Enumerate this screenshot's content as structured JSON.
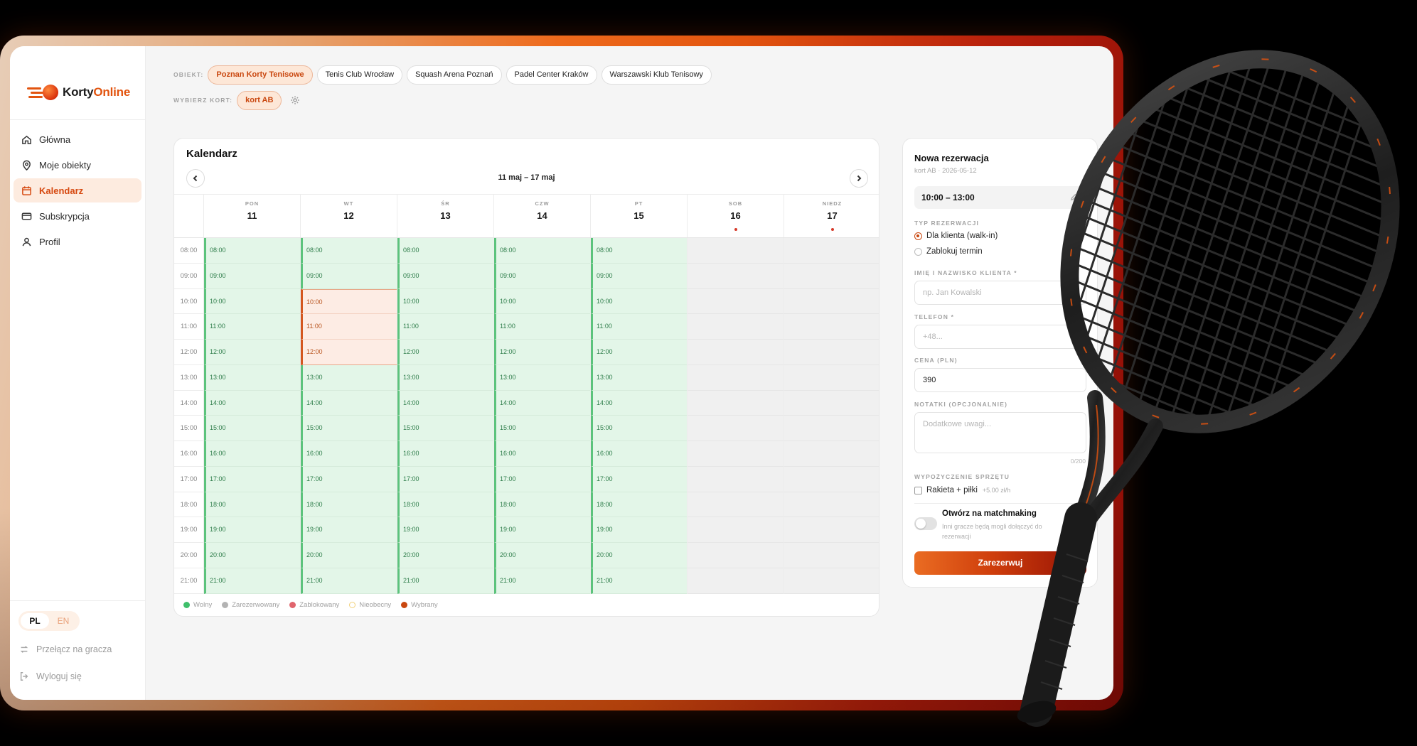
{
  "brand": {
    "name_part1": "Korty",
    "name_part2": "Online"
  },
  "sidebar": {
    "items": [
      {
        "label": "Główna",
        "icon": "home-icon",
        "active": false
      },
      {
        "label": "Moje obiekty",
        "icon": "map-pin-icon",
        "active": false
      },
      {
        "label": "Kalendarz",
        "icon": "calendar-icon",
        "active": true
      },
      {
        "label": "Subskrypcja",
        "icon": "card-icon",
        "active": false
      },
      {
        "label": "Profil",
        "icon": "user-icon",
        "active": false
      }
    ],
    "lang": {
      "pl": "PL",
      "en": "EN",
      "selected": "PL"
    },
    "switch_label": "Przełącz na gracza",
    "logout_label": "Wyloguj się"
  },
  "filters": {
    "facility_label": "OBIEKT:",
    "facilities": [
      "Poznan Korty Tenisowe",
      "Tenis Club Wrocław",
      "Squash Arena Poznań",
      "Padel Center Kraków",
      "Warszawski Klub Tenisowy"
    ],
    "selected_facility": "Poznan Korty Tenisowe",
    "court_label": "WYBIERZ KORT:",
    "court": "kort AB"
  },
  "calendar": {
    "title": "Kalendarz",
    "range": "11 maj – 17 maj",
    "days": [
      {
        "name": "PON",
        "date": "11",
        "marked": false,
        "available": true
      },
      {
        "name": "WT",
        "date": "12",
        "marked": false,
        "available": true
      },
      {
        "name": "ŚR",
        "date": "13",
        "marked": false,
        "available": true
      },
      {
        "name": "CZW",
        "date": "14",
        "marked": false,
        "available": true
      },
      {
        "name": "PT",
        "date": "15",
        "marked": false,
        "available": true
      },
      {
        "name": "SOB",
        "date": "16",
        "marked": true,
        "available": false
      },
      {
        "name": "NIEDZ",
        "date": "17",
        "marked": true,
        "available": false
      }
    ],
    "times": [
      "08:00",
      "09:00",
      "10:00",
      "11:00",
      "12:00",
      "13:00",
      "14:00",
      "15:00",
      "16:00",
      "17:00",
      "18:00",
      "19:00",
      "20:00",
      "21:00"
    ],
    "selection": {
      "day": "12",
      "times": [
        "10:00",
        "11:00",
        "12:00"
      ]
    },
    "legend": [
      {
        "label": "Wolny",
        "color": "#3fbf6b"
      },
      {
        "label": "Zarezerwowany",
        "color": "#b3b3b3"
      },
      {
        "label": "Zablokowany",
        "color": "#e0656d"
      },
      {
        "label": "Nieobecny",
        "color": "#f2d27b"
      },
      {
        "label": "Wybrany",
        "color": "#c9470f"
      }
    ]
  },
  "booking": {
    "title": "Nowa rezerwacja",
    "subtitle": "kort AB · 2026-05-12",
    "time": "10:00 – 13:00",
    "type_label": "TYP REZERWACJI",
    "type_options": [
      "Dla klienta (walk-in)",
      "Zablokuj termin"
    ],
    "name_label": "IMIĘ I NAZWISKO KLIENTA *",
    "name_placeholder": "np. Jan Kowalski",
    "phone_label": "TELEFON *",
    "phone_placeholder": "+48...",
    "price_label": "CENA (PLN)",
    "price_value": "390",
    "notes_label": "NOTATKI (OPCJONALNIE)",
    "notes_placeholder": "Dodatkowe uwagi...",
    "notes_counter": "0/200",
    "equipment_label": "WYPOŻYCZENIE SPRZĘTU",
    "equipment_option": "Rakieta + piłki",
    "equipment_price": "+5.00 zł/h",
    "matchmaking_title": "Otwórz na matchmaking",
    "matchmaking_desc": "Inni gracze będą mogli dołączyć do rezerwacji",
    "submit_label": "Zarezerwuj"
  }
}
